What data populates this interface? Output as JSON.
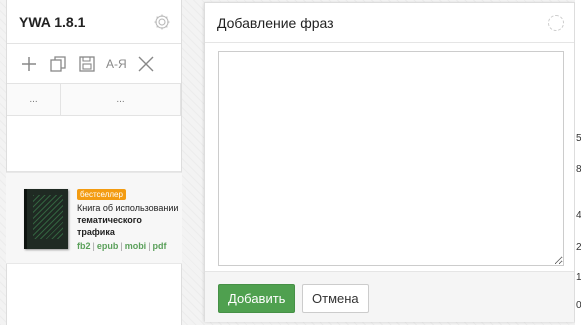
{
  "app": {
    "title": "YWA 1.8.1"
  },
  "toolbar": {
    "add_icon": "plus-icon",
    "copy_icon": "copy-icon",
    "export_icon": "save-icon",
    "az_label": "А-Я",
    "close_icon": "close-icon"
  },
  "tabs": [
    {
      "label": "..."
    },
    {
      "label": "..."
    }
  ],
  "promo": {
    "badge": "бестселлер",
    "line1": "Книга об использовании",
    "line2": "тематического трафика",
    "formats": [
      "fb2",
      "epub",
      "mobi",
      "pdf"
    ]
  },
  "dialog": {
    "title": "Добавление фраз",
    "textarea_value": "",
    "add_button": "Добавить",
    "cancel_button": "Отмена"
  },
  "edge_digits": [
    "5",
    "8",
    "4",
    "2",
    "1",
    "0"
  ],
  "colors": {
    "accent_green": "#4fa04f",
    "badge_orange": "#f39c12"
  }
}
